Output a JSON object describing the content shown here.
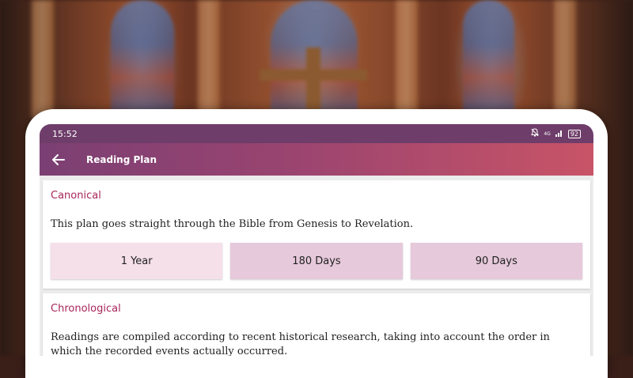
{
  "status_bar": {
    "time": "15:52",
    "network": "4G",
    "battery": "92"
  },
  "app_bar": {
    "title": "Reading Plan",
    "back_icon": "arrow-left-icon"
  },
  "plans": [
    {
      "title": "Canonical",
      "description": "This plan goes straight through the Bible from Genesis to Revelation.",
      "options": [
        "1 Year",
        "180 Days",
        "90 Days"
      ]
    },
    {
      "title": "Chronological",
      "description": "Readings are compiled according to recent historical research, taking into account the order in which the recorded events actually occurred."
    }
  ],
  "colors": {
    "accent": "#a8255a",
    "status_bar": "#6e3d6a",
    "app_bar_start": "#7b3f73",
    "app_bar_end": "#c85467",
    "option_selected": "#f5dfe9",
    "option": "#e6c9db"
  }
}
